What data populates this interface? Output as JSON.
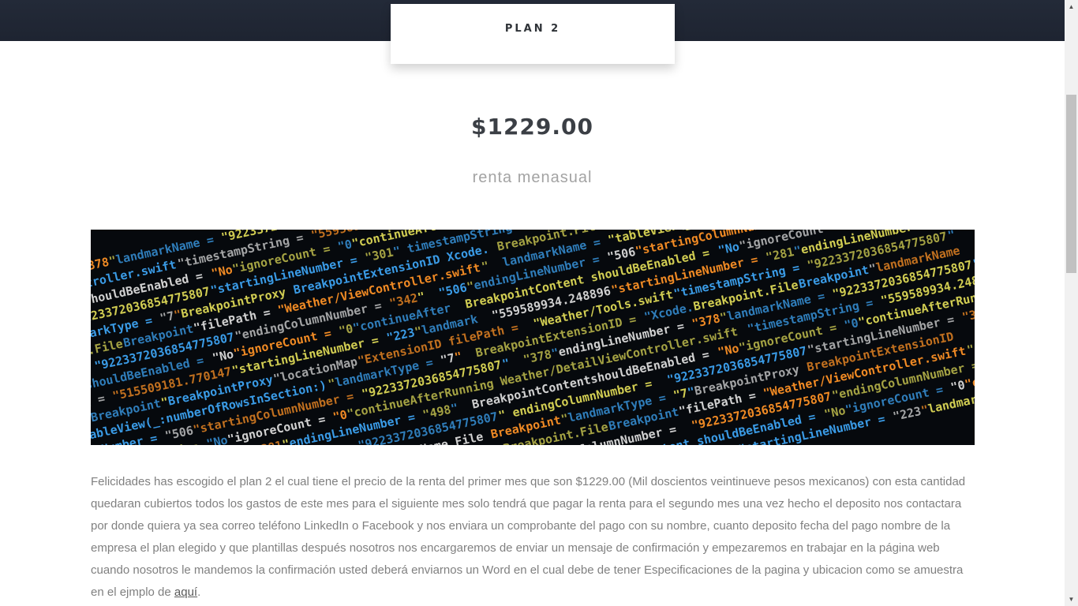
{
  "plan_tab": {
    "label": "PLAN 2"
  },
  "pricing": {
    "price": "$1229.00",
    "subtitle": "renta menasual"
  },
  "hero_image": {
    "alt": "code screenshot",
    "code_lines": [
      "\"378\"endingLineNumber = \"378\"landmarkName = \"9223372036854775807\"",
      "Weather/DetailViewController.swift\"timestampString = \"559589934.248209\"",
      "BreakpointContentshouldBeEnabled = \"No\"ignoreCount = \"0\"continueAfterRunningActions",
      "endingColumnNumber = \"9223372036854775807\"startingLineNumber = \"301\"",
      "FileBreakpoint\"landmarkType = \"7\"BreakpointProxy BreakpointExtensionID",
      "Xcode.Breakpoint.FileBreakpoint\"filePath = \"Weather/ViewController.swift\"",
      "startingColumnNumber = \"9223372036854775807\"endingColumnNumber = \"342\"",
      "BreakpointContent shouldBeEnabled = \"No\"ignoreCount = \"0\"continueAfter",
      "timestampString = \"515509181.770147\"startingLineNumber = \"223\"landmark",
      "Xcode.Breakpoint.FileBreakpoint\"BreakpointProxy\"locationMap\"ExtensionID",
      "landmarkName = \"tableView(_:numberOfRowsInSection:)\"landmarkType = \"7\"",
      "\"506\"endingLineNumber = \"506\"startingColumnNumber = \"9223372036854775807\"",
      "BreakpointContent shouldBeEnabled = \"No\"ignoreCount = \"0\"continueAfterRunning",
      "\"559589934.248896\"startingLineNumber = \"281\"endingLineNumber = \"498\"",
      "filePath = \"Weather/Tools.swift\"timestampString = \"9223372036854775807\"",
      "BreakpointExtensionID = \"Xcode.Breakpoint.FileBreakpoint\"landmarkName"
    ]
  },
  "description": {
    "text": "Felicidades has escogido el plan 2 el cual tiene el precio de la renta del primer mes que son $1229.00 (Mil doscientos veintinueve pesos mexicanos) con esta cantidad quedaran cubiertos todos los gastos de este mes para el siguiente mes solo tendrá que pagar la renta para el segundo mes una vez hecho el deposito nos contactara por donde quiera ya sea correo teléfono LinkedIn o Facebook y nos enviara un comprobante del pago con su nombre, cuanto deposito fecha del pago nombre de la empresa el plan elegido y que plantillas después nosotros nos encargaremos de enviar un mensaje de confirmación y empezaremos en trabajar en la página web cuando nosotros le mandemos la confirmación usted deberá enviarnos un Word en el cual debe de tener Especificaciones de la pagina y ubicacion como se amuestra en el ejmplo de",
    "link_label": "aquí",
    "end": "."
  },
  "colors": {
    "header_bg": "#1e2431",
    "price_text": "#3b3f45",
    "subtitle_text": "#a3a3a3",
    "body_text": "#808080",
    "code_yellow": "#e8e35a",
    "code_blue": "#3a9be6",
    "code_white": "#e6e6e6",
    "code_orange": "#f08a24"
  }
}
